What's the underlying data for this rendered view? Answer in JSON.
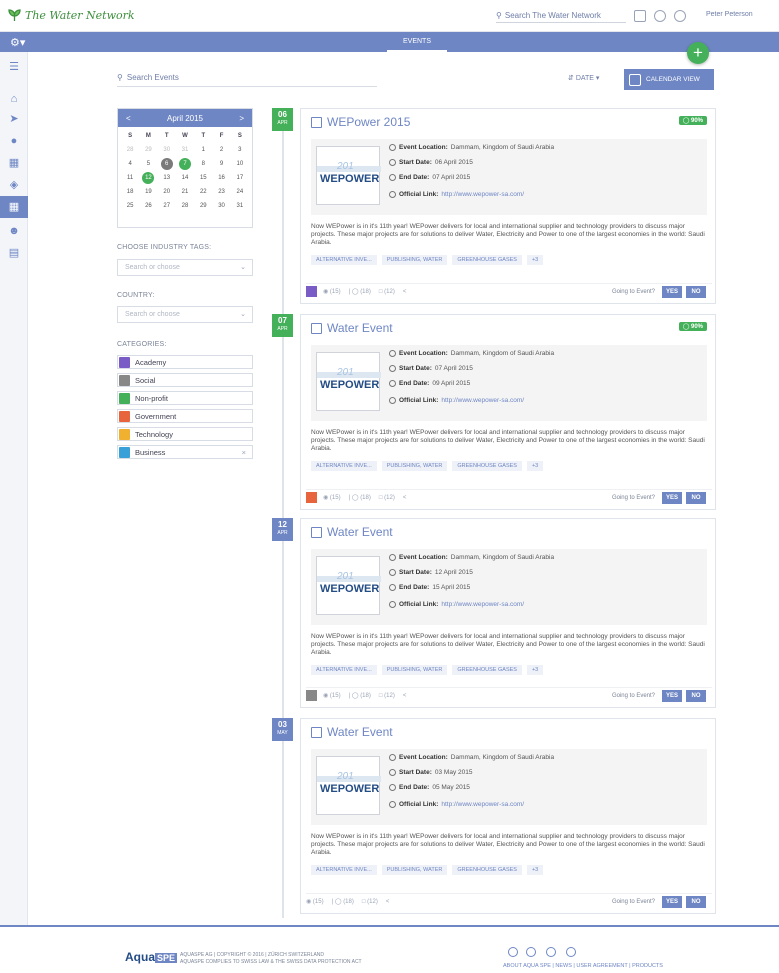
{
  "header": {
    "brand": "The Water Network",
    "search_placeholder": "Search The Water Network",
    "user": "Peter Peterson"
  },
  "nav": {
    "tab": "EVENTS"
  },
  "toolbar": {
    "search_placeholder": "Search Events",
    "sort": "DATE",
    "calendar_view": "CALENDAR VIEW"
  },
  "calendar": {
    "month": "April 2015",
    "prev": "<",
    "next": ">",
    "days": [
      "S",
      "M",
      "T",
      "W",
      "T",
      "F",
      "S"
    ],
    "weeks": [
      [
        "28",
        "29",
        "30",
        "31",
        "1",
        "2",
        "3"
      ],
      [
        "4",
        "5",
        "6",
        "7",
        "8",
        "9",
        "10"
      ],
      [
        "11",
        "12",
        "13",
        "14",
        "15",
        "16",
        "17"
      ],
      [
        "18",
        "19",
        "20",
        "21",
        "22",
        "23",
        "24"
      ],
      [
        "25",
        "26",
        "27",
        "28",
        "29",
        "30",
        "31"
      ]
    ]
  },
  "filters": {
    "industry_label": "CHOOSE INDUSTRY TAGS:",
    "industry_placeholder": "Search or choose",
    "country_label": "COUNTRY:",
    "country_placeholder": "Search or choose",
    "categories_label": "CATEGORIES:",
    "categories": [
      {
        "name": "Academy",
        "color": "#7a5cc6"
      },
      {
        "name": "Social",
        "color": "#888888"
      },
      {
        "name": "Non-profit",
        "color": "#45b05a"
      },
      {
        "name": "Government",
        "color": "#e8643c"
      },
      {
        "name": "Technology",
        "color": "#f0b030"
      },
      {
        "name": "Business",
        "color": "#3aa0d8"
      }
    ]
  },
  "events": [
    {
      "day": "06",
      "month": "APR",
      "title": "WEPower 2015",
      "pct": "90%",
      "location": "Dammam, Kingdom of Saudi Arabia",
      "start": "06 April 2015",
      "end": "07 April 2015",
      "link": "http://www.wepower-sa.com/",
      "desc": "Now WEPower is in it's 11th year! WEPower delivers for local and international supplier and technology providers to discuss major projects. These major projects are for solutions to deliver Water, Electricity and Power to one of the largest economies in the world: Saudi Arabia.",
      "views": "(15)",
      "going": "(18)",
      "comments": "(12)"
    },
    {
      "day": "07",
      "month": "APR",
      "title": "Water Event",
      "pct": "90%",
      "location": "Dammam, Kingdom of Saudi Arabia",
      "start": "07 April 2015",
      "end": "09 April 2015",
      "link": "http://www.wepower-sa.com/",
      "desc": "Now WEPower is in it's 11th year! WEPower delivers for local and international supplier and technology providers to discuss major projects. These major projects are for solutions to deliver Water, Electricity and Power to one of the largest economies in the world: Saudi Arabia.",
      "views": "(15)",
      "going": "(18)",
      "comments": "(12)"
    },
    {
      "day": "12",
      "month": "APR",
      "title": "Water Event",
      "pct": "",
      "location": "Dammam, Kingdom of Saudi Arabia",
      "start": "12 April 2015",
      "end": "15 April 2015",
      "link": "http://www.wepower-sa.com/",
      "desc": "Now WEPower is in it's 11th year! WEPower delivers for local and international supplier and technology providers to discuss major projects. These major projects are for solutions to deliver Water, Electricity and Power to one of the largest economies in the world: Saudi Arabia.",
      "views": "(15)",
      "going": "(18)",
      "comments": "(12)"
    },
    {
      "day": "03",
      "month": "MAY",
      "title": "Water Event",
      "pct": "",
      "location": "Dammam, Kingdom of Saudi Arabia",
      "start": "03 May 2015",
      "end": "05 May 2015",
      "link": "http://www.wepower-sa.com/",
      "desc": "Now WEPower is in it's 11th year! WEPower delivers for local and international supplier and technology providers to discuss major projects. These major projects are for solutions to deliver Water, Electricity and Power to one of the largest economies in the world: Saudi Arabia.",
      "views": "(15)",
      "going": "(18)",
      "comments": "(12)"
    }
  ],
  "labels": {
    "location": "Event Location:",
    "start": "Start Date:",
    "end": "End Date:",
    "link": "Official Link:",
    "going": "Going to Event?",
    "yes": "YES",
    "no": "NO",
    "tags": [
      "ALTERNATIVE INVE...",
      "PUBLISHING, WATER",
      "GREENHOUSE GASES"
    ],
    "more": "+3"
  },
  "footer": {
    "brand": "Aqua",
    "brand_tag": "SPE",
    "copy1": "AQUASPE AG | COPYRIGHT © 2016 | ZÜRICH SWITZERLAND",
    "copy2": "AQUASPE COMPLIES TO SWISS LAW & THE SWISS DATA PROTECTION ACT",
    "links": "ABOUT AQUA SPE | NEWS | USER AGREEMENT | PRODUCTS"
  }
}
